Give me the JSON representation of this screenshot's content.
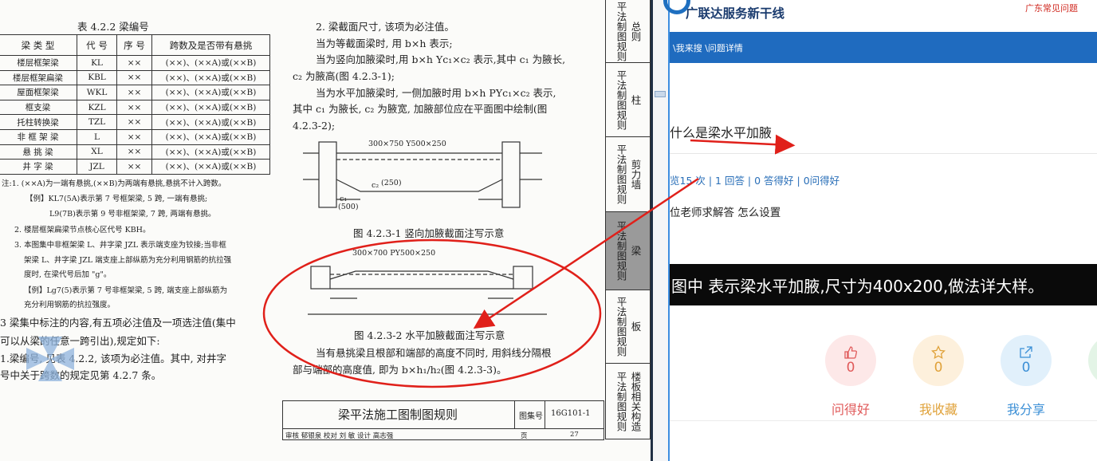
{
  "document": {
    "table_caption": "表 4.2.2  梁编号",
    "table": {
      "headers": [
        "梁 类 型",
        "代 号",
        "序 号",
        "跨数及是否带有悬挑"
      ],
      "rows": [
        [
          "楼层框架梁",
          "KL",
          "××",
          "(××)、(××A)或(××B)"
        ],
        [
          "楼层框架扁梁",
          "KBL",
          "××",
          "(××)、(××A)或(××B)"
        ],
        [
          "屋面框架梁",
          "WKL",
          "××",
          "(××)、(××A)或(××B)"
        ],
        [
          "框支梁",
          "KZL",
          "××",
          "(××)、(××A)或(××B)"
        ],
        [
          "托柱转换梁",
          "TZL",
          "××",
          "(××)、(××A)或(××B)"
        ],
        [
          "非 框 架 梁",
          "L",
          "××",
          "(××)、(××A)或(××B)"
        ],
        [
          "悬 挑 梁",
          "XL",
          "××",
          "(××)、(××A)或(××B)"
        ],
        [
          "井 字 梁",
          "JZL",
          "××",
          "(××)、(××A)或(××B)"
        ]
      ]
    },
    "notes": [
      "注:1. (××A)为一端有悬挑,(××B)为两端有悬挑,悬挑不计入跨数。",
      "【例】KL7(5A)表示第 7 号框架梁, 5 跨, 一端有悬挑;",
      "L9(7B)表示第 9 号非框架梁, 7 跨, 两端有悬挑。",
      "2. 楼层框架扁梁节点核心区代号 KBH。",
      "3. 本图集中非框架梁 L、井字梁 JZL 表示端支座为铰接;当非框",
      "架梁 L、井字梁 JZL 端支座上部纵筋为充分利用钢筋的抗拉强",
      "度时, 在梁代号后加 \"g\"。",
      "【例】Lg7(5)表示第 7 号非框架梁, 5 跨, 端支座上部纵筋为",
      "充分利用钢筋的抗拉强度。"
    ],
    "left_body": [
      "3  梁集中标注的内容,有五项必注值及一项选注值(集中",
      "可以从梁的任意一跨引出),规定如下:",
      "1.梁编号, 见表 4.2.2, 该项为必注值。其中, 对井字",
      "号中关于跨数的规定见第 4.2.7 条。"
    ],
    "right_body": [
      "2. 梁截面尺寸, 该项为必注值。",
      "当为等截面梁时, 用 b×h 表示;",
      "当为竖向加腋梁时,用 b×h  Yc₁×c₂ 表示,其中 c₁ 为腋长,",
      "c₂ 为腋高(图 4.2.3-1);",
      "当为水平加腋梁时, 一侧加腋时用 b×h  PYc₁×c₂ 表示,",
      "其中 c₁ 为腋长, c₂ 为腋宽, 加腋部位应在平面图中绘制(图",
      "4.2.3-2);"
    ],
    "fig1": {
      "label": "300×750 Y500×250",
      "dims": [
        "c₁",
        "c₂",
        "(250)",
        "(500)"
      ],
      "caption": "图 4.2.3-1  竖向加腋截面注写示意"
    },
    "fig2": {
      "label": "300×700  PY500×250",
      "caption": "图 4.2.3-2  水平加腋截面注写示意"
    },
    "after_fig": [
      "当有悬挑梁且根部和端部的高度不同时, 用斜线分隔根",
      "部与端部的高度值, 即为 b×h₁/h₂(图 4.2.3-3)。"
    ],
    "side_tabs": [
      {
        "cols": [
          "平法制图规则",
          "总则"
        ]
      },
      {
        "cols": [
          "平法制图规则",
          "柱"
        ]
      },
      {
        "cols": [
          "平法制图规则",
          "剪力墙"
        ]
      },
      {
        "cols": [
          "平法制图规则",
          "梁"
        ]
      },
      {
        "cols": [
          "平法制图规则",
          "板"
        ]
      },
      {
        "cols": [
          "平法制图规则",
          "楼板相关构造"
        ]
      }
    ],
    "title_block": {
      "title": "梁平法施工图制图规则",
      "atlas_label": "图集号",
      "atlas_no": "16G101-1",
      "page_label": "页",
      "page_no": "27",
      "row2": "审核 郁银泉   校对 刘  敏   设计 高志强"
    }
  },
  "web": {
    "brand": "广联达服务新干线",
    "top_links": "广东常见问题  ",
    "breadcrumb": "\\我来搜 \\问题详情",
    "question_title": "什么是梁水平加腋",
    "stats": "览15 次 | 1 回答 | 0 答得好 | 0问得好",
    "question_body": "位老师求解答   怎么设置",
    "answer_text": "图中   表示梁水平加腋,尺寸为400x200,做法详大样。",
    "actions": [
      {
        "label": "问得好",
        "count": "0",
        "icon": "thumbs-up-icon",
        "color": "#e05a5a",
        "bg": "#fde8e8"
      },
      {
        "label": "我收藏",
        "count": "0",
        "icon": "star-icon",
        "color": "#e0a23a",
        "bg": "#fdf0dc"
      },
      {
        "label": "我分享",
        "count": "0",
        "icon": "share-icon",
        "color": "#3b8fd6",
        "bg": "#e1f0fb"
      },
      {
        "label": "我",
        "count": "",
        "icon": "partial-icon",
        "color": "#3aa55a",
        "bg": "#e3f4e6"
      }
    ],
    "colors": {
      "nav": "#1f6bbf",
      "brand": "#1a3b6e",
      "link": "#2a6fb8",
      "arrow": "#e0201a"
    }
  }
}
